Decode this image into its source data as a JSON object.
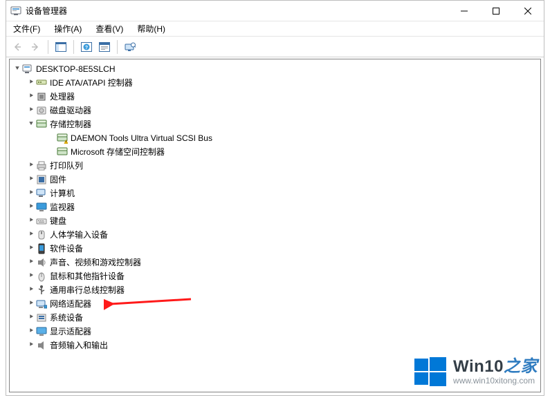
{
  "window": {
    "title": "设备管理器"
  },
  "menu": {
    "file": "文件(F)",
    "action": "操作(A)",
    "view": "查看(V)",
    "help": "帮助(H)"
  },
  "toolbar": {
    "back": "后退",
    "forward": "前进",
    "showhide": "显示/隐藏控制台树",
    "help": "帮助",
    "properties": "属性",
    "scan": "扫描硬件更改"
  },
  "tree": {
    "root": "DESKTOP-8E5SLCH",
    "nodes": [
      {
        "label": "IDE ATA/ATAPI 控制器",
        "icon": "ide",
        "expanded": false
      },
      {
        "label": "处理器",
        "icon": "cpu",
        "expanded": false
      },
      {
        "label": "磁盘驱动器",
        "icon": "disk",
        "expanded": false
      },
      {
        "label": "存储控制器",
        "icon": "storage",
        "expanded": true,
        "children": [
          {
            "label": "DAEMON Tools Ultra Virtual SCSI Bus",
            "icon": "storage-warn"
          },
          {
            "label": "Microsoft 存储空间控制器",
            "icon": "storage"
          }
        ]
      },
      {
        "label": "打印队列",
        "icon": "printer",
        "expanded": false
      },
      {
        "label": "固件",
        "icon": "firmware",
        "expanded": false
      },
      {
        "label": "计算机",
        "icon": "computer",
        "expanded": false
      },
      {
        "label": "监视器",
        "icon": "monitor",
        "expanded": false
      },
      {
        "label": "键盘",
        "icon": "keyboard",
        "expanded": false
      },
      {
        "label": "人体学输入设备",
        "icon": "hid",
        "expanded": false
      },
      {
        "label": "软件设备",
        "icon": "software",
        "expanded": false
      },
      {
        "label": "声音、视频和游戏控制器",
        "icon": "audio",
        "expanded": false
      },
      {
        "label": "鼠标和其他指针设备",
        "icon": "mouse",
        "expanded": false
      },
      {
        "label": "通用串行总线控制器",
        "icon": "usb",
        "expanded": false
      },
      {
        "label": "网络适配器",
        "icon": "network",
        "expanded": false,
        "highlight": true
      },
      {
        "label": "系统设备",
        "icon": "system",
        "expanded": false
      },
      {
        "label": "显示适配器",
        "icon": "display",
        "expanded": false
      },
      {
        "label": "音频输入和输出",
        "icon": "audioio",
        "expanded": false
      }
    ]
  },
  "watermark": {
    "brand_prefix": "Win10",
    "brand_suffix": "之家",
    "url": "www.win10xitong.com"
  }
}
